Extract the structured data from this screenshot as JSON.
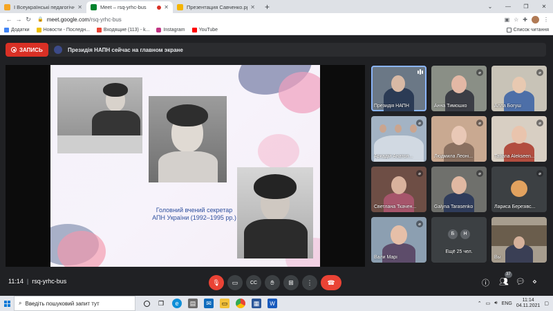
{
  "browser": {
    "tabs": [
      {
        "title": "І Всеукраїнські педагогічні читання",
        "active": false,
        "color": "#f5a623"
      },
      {
        "title": "Meet – rsq-yrhc-bus",
        "active": true,
        "color": "#00832d"
      },
      {
        "title": "Презентация Савченко.pptx - G",
        "active": false,
        "color": "#f4b400"
      }
    ],
    "url_host": "meet.google.com",
    "url_path": "/rsq-yrhc-bus",
    "bookmarks": [
      "Додатки",
      "Новости - Последн...",
      "Входящие (113) - k...",
      "Instagram",
      "YouTube"
    ],
    "reading_list": "Список читання"
  },
  "meet": {
    "record_label": "ЗАПИСЬ",
    "presenting_text": "Президія НАПН сейчас на главном экране",
    "slide_caption": "Головний вчений секретар АПН  України (1992–1995 рр.)",
    "participants": [
      {
        "name": "Президія НАПН",
        "speaking": true
      },
      {
        "name": "Анна Тимошко",
        "speaking": false
      },
      {
        "name": "Алла Богуш",
        "speaking": false
      },
      {
        "name": "Аркадій Анатол...",
        "speaking": false
      },
      {
        "name": "Людмила Леоні...",
        "speaking": false
      },
      {
        "name": "Tatiana Alekseen...",
        "speaking": false
      },
      {
        "name": "Светлана Ткачен...",
        "speaking": false
      },
      {
        "name": "Galyna Tarasenko",
        "speaking": false
      },
      {
        "name": "Лариса Березівс...",
        "speaking": false
      },
      {
        "name": "Вали Марі",
        "speaking": false
      },
      {
        "name": "Ещё 25 чел.",
        "speaking": false
      },
      {
        "name": "Вы",
        "speaking": false
      }
    ],
    "more_initials": [
      "Б",
      "Н"
    ],
    "time": "11:14",
    "meeting_code": "rsq-yrhc-bus",
    "people_count": "37"
  },
  "taskbar": {
    "search_placeholder": "Введіть пошуковий запит тут",
    "language": "ENG",
    "time": "11:14",
    "date": "04.11.2021"
  }
}
